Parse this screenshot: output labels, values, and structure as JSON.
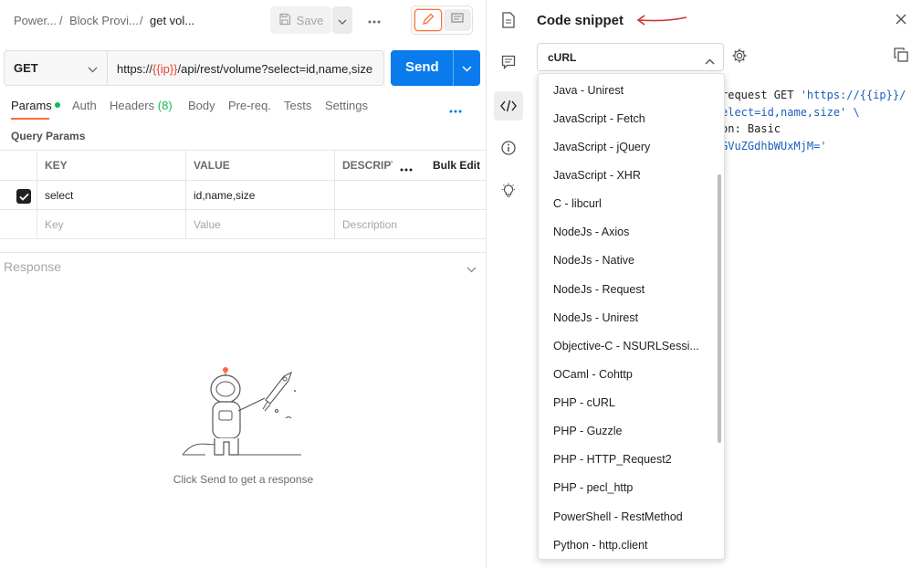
{
  "breadcrumb": {
    "item1": "Power...",
    "item2": "Block Provi...",
    "item3": "get vol...",
    "separator": "/"
  },
  "toolbar": {
    "save_label": "Save"
  },
  "request": {
    "method": "GET",
    "url_prefix": "https://",
    "url_var": "{{ip}}",
    "url_suffix": "/api/rest/volume?select=id,name,size",
    "send_label": "Send"
  },
  "tabs": {
    "params": "Params",
    "auth": "Auth",
    "headers": "Headers",
    "headers_count": "(8)",
    "body": "Body",
    "prereq": "Pre-req.",
    "tests": "Tests",
    "settings": "Settings"
  },
  "params": {
    "title": "Query Params",
    "col_key": "KEY",
    "col_value": "VALUE",
    "col_desc": "DESCRIPTI",
    "bulk_edit": "Bulk Edit",
    "row1": {
      "key": "select",
      "value": "id,name,size",
      "checked": true
    },
    "empty": {
      "key": "Key",
      "value": "Value",
      "desc": "Description"
    }
  },
  "response": {
    "label": "Response",
    "hint": "Click Send to get a response"
  },
  "snippet": {
    "title": "Code snippet",
    "language": "cURL",
    "code_line1_a": "request GET ",
    "code_line1_b": "'https://{{ip}}/",
    "code_line2": "elect=id,name,size' \\",
    "code_line3": "on: Basic",
    "code_line4": "GVuZGdhbWUxMjM='"
  },
  "languages": [
    "Java - Unirest",
    "JavaScript - Fetch",
    "JavaScript - jQuery",
    "JavaScript - XHR",
    "C - libcurl",
    "NodeJs - Axios",
    "NodeJs - Native",
    "NodeJs - Request",
    "NodeJs - Unirest",
    "Objective-C - NSURLSessi...",
    "OCaml - Cohttp",
    "PHP - cURL",
    "PHP - Guzzle",
    "PHP - HTTP_Request2",
    "PHP - pecl_http",
    "PowerShell - RestMethod",
    "Python - http.client"
  ],
  "colors": {
    "accent": "#ff6c37",
    "send": "#097bed",
    "status_green": "#0cbb52",
    "variable": "#e3472d",
    "annotation_arrow": "#d32f2f"
  },
  "icons": [
    "save-icon",
    "chevron-down-icon",
    "more-icon",
    "edit-icon",
    "comment-icon",
    "document-icon",
    "code-icon",
    "info-icon",
    "lightbulb-icon",
    "settings-icon",
    "copy-icon",
    "close-icon"
  ]
}
